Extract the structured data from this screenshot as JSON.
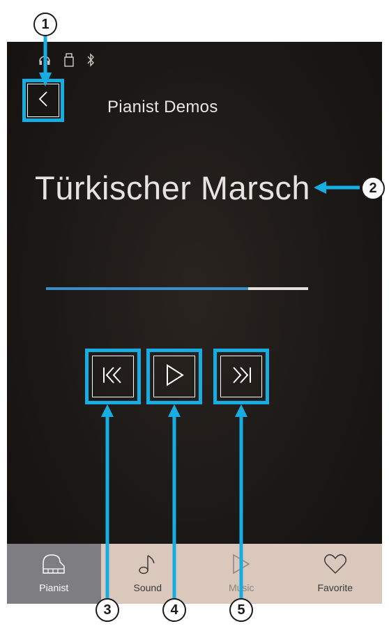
{
  "header": {
    "title": "Pianist Demos"
  },
  "song": {
    "title": "Türkischer Marsch"
  },
  "progress": {
    "fraction": 0.77
  },
  "status_icons": [
    "headphones-icon",
    "usb-icon",
    "bluetooth-icon"
  ],
  "controls": {
    "previous_icon": "skip-previous-icon",
    "play_icon": "play-icon",
    "next_icon": "skip-next-icon"
  },
  "tabs": [
    {
      "label": "Pianist",
      "icon": "piano-icon",
      "active": true
    },
    {
      "label": "Sound",
      "icon": "music-note-icon",
      "active": false
    },
    {
      "label": "Music",
      "icon": "play-outline-icon",
      "active": false
    },
    {
      "label": "Favorite",
      "icon": "heart-icon",
      "active": false
    }
  ],
  "callouts": [
    "1",
    "2",
    "3",
    "4",
    "5"
  ],
  "colors": {
    "highlight": "#16aee2",
    "progress_fill": "#3a8dc6",
    "tabbar_bg": "#dac8bc",
    "tab_active_bg": "#7d7d82"
  }
}
